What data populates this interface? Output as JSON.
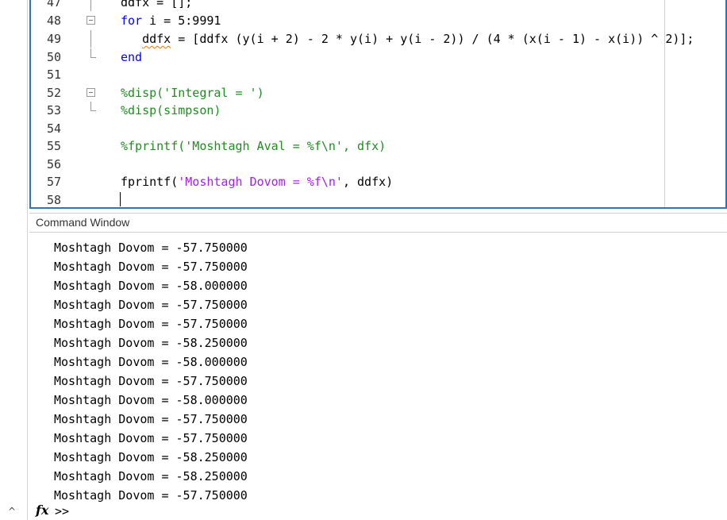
{
  "editor": {
    "lines": [
      {
        "num": "47",
        "fold": "mid",
        "parts": [
          {
            "t": "ddfx = [];",
            "c": "plain"
          }
        ]
      },
      {
        "num": "48",
        "fold": "box",
        "parts": [
          {
            "t": "for",
            "c": "kw"
          },
          {
            "t": " i = 5:9991",
            "c": "plain"
          }
        ]
      },
      {
        "num": "49",
        "fold": "mid",
        "parts": [
          {
            "t": "   ",
            "c": "plain"
          },
          {
            "t": "ddfx",
            "c": "squig"
          },
          {
            "t": " = [ddfx (y(i + 2) - 2 * y(i) + y(i - 2)) / (4 * (x(i - 1) - x(i)) ^ 2)];",
            "c": "plain"
          }
        ]
      },
      {
        "num": "50",
        "fold": "end",
        "parts": [
          {
            "t": "end",
            "c": "kw"
          }
        ]
      },
      {
        "num": "51",
        "fold": "",
        "parts": []
      },
      {
        "num": "52",
        "fold": "box",
        "parts": [
          {
            "t": "%disp('Integral = ')",
            "c": "cm"
          }
        ]
      },
      {
        "num": "53",
        "fold": "end",
        "parts": [
          {
            "t": "%disp(simpson)",
            "c": "cm"
          }
        ]
      },
      {
        "num": "54",
        "fold": "",
        "parts": []
      },
      {
        "num": "55",
        "fold": "",
        "parts": [
          {
            "t": "%fprintf('Moshtagh Aval = %f\\n', dfx)",
            "c": "cm"
          }
        ]
      },
      {
        "num": "56",
        "fold": "",
        "parts": []
      },
      {
        "num": "57",
        "fold": "",
        "parts": [
          {
            "t": "fprintf(",
            "c": "plain"
          },
          {
            "t": "'Moshtagh Dovom = %f\\n'",
            "c": "str"
          },
          {
            "t": ", ddfx)",
            "c": "plain"
          }
        ]
      },
      {
        "num": "58",
        "fold": "",
        "parts": []
      }
    ]
  },
  "command_window": {
    "title": "Command Window",
    "output": [
      "Moshtagh Dovom = -57.750000",
      "Moshtagh Dovom = -57.750000",
      "Moshtagh Dovom = -58.000000",
      "Moshtagh Dovom = -57.750000",
      "Moshtagh Dovom = -57.750000",
      "Moshtagh Dovom = -58.250000",
      "Moshtagh Dovom = -58.000000",
      "Moshtagh Dovom = -57.750000",
      "Moshtagh Dovom = -58.000000",
      "Moshtagh Dovom = -57.750000",
      "Moshtagh Dovom = -57.750000",
      "Moshtagh Dovom = -58.250000",
      "Moshtagh Dovom = -58.250000",
      "Moshtagh Dovom = -57.750000"
    ],
    "fx_label": "fx",
    "prompt": ">>"
  },
  "left_panel": {
    "collapse_glyph": "^",
    "collapse_icon": "chevron-up-icon"
  }
}
